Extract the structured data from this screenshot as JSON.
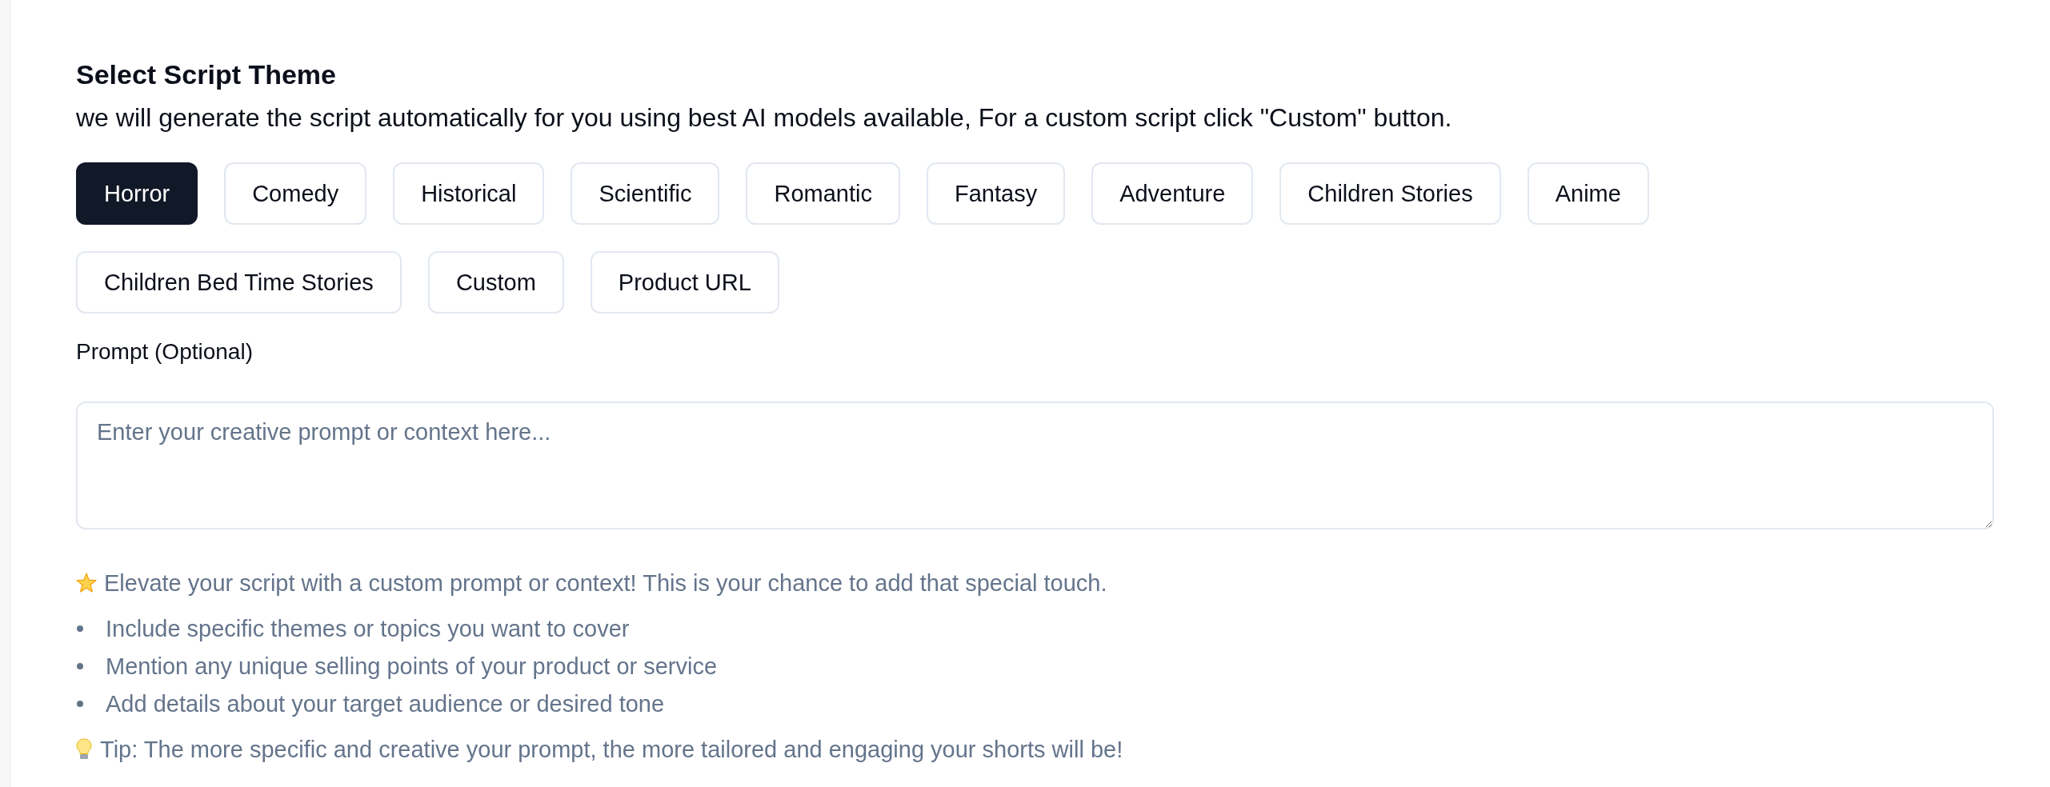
{
  "header": {
    "title": "Select Script Theme",
    "description": "we will generate the script automatically for you using best AI models available, For a custom script click \"Custom\" button."
  },
  "themes": [
    {
      "label": "Horror",
      "selected": true
    },
    {
      "label": "Comedy",
      "selected": false
    },
    {
      "label": "Historical",
      "selected": false
    },
    {
      "label": "Scientific",
      "selected": false
    },
    {
      "label": "Romantic",
      "selected": false
    },
    {
      "label": "Fantasy",
      "selected": false
    },
    {
      "label": "Adventure",
      "selected": false
    },
    {
      "label": "Children Stories",
      "selected": false
    },
    {
      "label": "Anime",
      "selected": false
    },
    {
      "label": "Children Bed Time Stories",
      "selected": false
    },
    {
      "label": "Custom",
      "selected": false
    },
    {
      "label": "Product URL",
      "selected": false
    }
  ],
  "prompt": {
    "label": "Prompt (Optional)",
    "placeholder": "Enter your creative prompt or context here..."
  },
  "tips": {
    "intro": "Elevate your script with a custom prompt or context! This is your chance to add that special touch.",
    "bullets": [
      "Include specific themes or topics you want to cover",
      "Mention any unique selling points of your product or service",
      "Add details about your target audience or desired tone"
    ],
    "tip": "Tip: The more specific and creative your prompt, the more tailored and engaging your shorts will be!"
  }
}
